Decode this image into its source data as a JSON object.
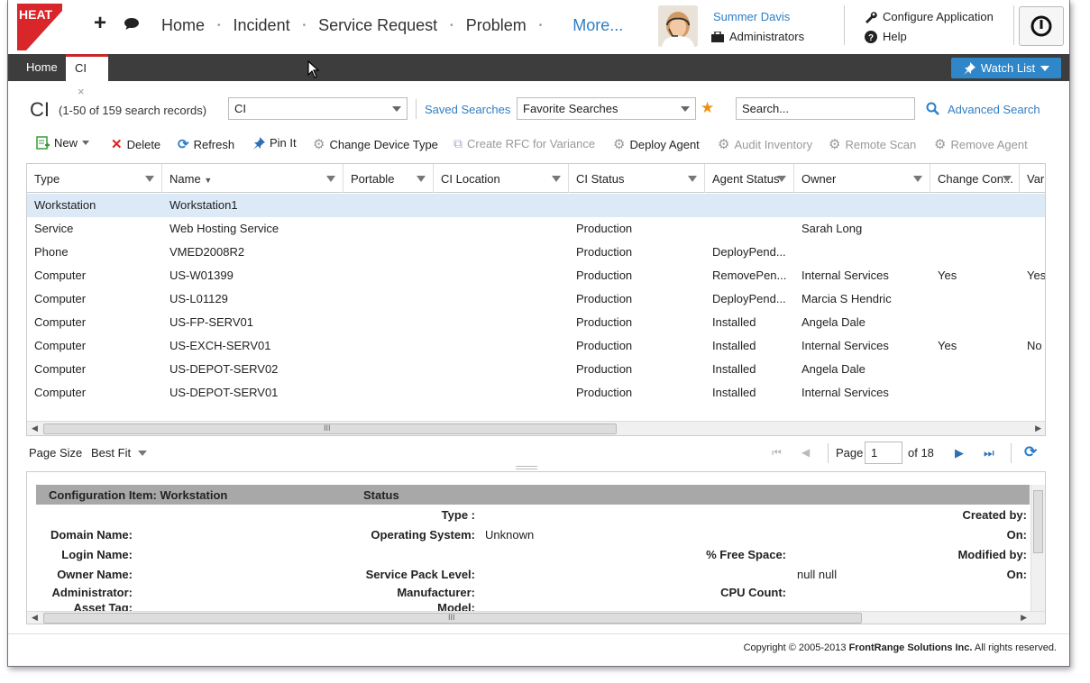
{
  "header": {
    "logo_text": "HEAT",
    "nav": [
      "Home",
      "Incident",
      "Service Request",
      "Problem"
    ],
    "more": "More...",
    "user_name": "Summer Davis",
    "user_role": "Administrators",
    "configure": "Configure Application",
    "help": "Help"
  },
  "tabs": {
    "home": "Home",
    "ci": "CI",
    "close": "×",
    "watch_list": "Watch List"
  },
  "search": {
    "title": "CI",
    "count": "(1-50 of 159 search records)",
    "object_value": "CI",
    "saved_searches": "Saved Searches",
    "favorite_value": "Favorite Searches",
    "search_placeholder": "Search...",
    "advanced": "Advanced Search"
  },
  "toolbar": {
    "new": "New",
    "delete": "Delete",
    "refresh": "Refresh",
    "pin": "Pin It",
    "change_type": "Change Device Type",
    "create_rfc": "Create RFC for Variance",
    "deploy": "Deploy Agent",
    "audit": "Audit Inventory",
    "remote_scan": "Remote Scan",
    "remove_agent": "Remove Agent"
  },
  "grid": {
    "columns": [
      "Type",
      "Name",
      "Portable",
      "CI Location",
      "CI Status",
      "Agent Status",
      "Owner",
      "Change Con...",
      "Vari"
    ],
    "rows": [
      [
        "Workstation",
        "Workstation1",
        "",
        "",
        "",
        "",
        "",
        "",
        ""
      ],
      [
        "Service",
        "Web Hosting Service",
        "",
        "",
        "Production",
        "",
        "Sarah Long",
        "",
        ""
      ],
      [
        "Phone",
        "VMED2008R2",
        "",
        "",
        "Production",
        "DeployPend...",
        "",
        "",
        ""
      ],
      [
        "Computer",
        "US-W01399",
        "",
        "",
        "Production",
        "RemovePen...",
        "Internal Services",
        "Yes",
        "Yes"
      ],
      [
        "Computer",
        "US-L01129",
        "",
        "",
        "Production",
        "DeployPend...",
        "Marcia S Hendric",
        "",
        ""
      ],
      [
        "Computer",
        "US-FP-SERV01",
        "",
        "",
        "Production",
        "Installed",
        "Angela Dale",
        "",
        ""
      ],
      [
        "Computer",
        "US-EXCH-SERV01",
        "",
        "",
        "Production",
        "Installed",
        "Internal Services",
        "Yes",
        "No"
      ],
      [
        "Computer",
        "US-DEPOT-SERV02",
        "",
        "",
        "Production",
        "Installed",
        "Angela Dale",
        "",
        ""
      ],
      [
        "Computer",
        "US-DEPOT-SERV01",
        "",
        "",
        "Production",
        "Installed",
        "Internal Services",
        "",
        ""
      ]
    ],
    "scroll_grip": "III"
  },
  "pager": {
    "page_size_label": "Page Size",
    "page_size_value": "Best Fit",
    "page_label": "Page",
    "page_value": "1",
    "of_label": "of 18"
  },
  "detail": {
    "header_title": "Configuration Item: Workstation",
    "header_status": "Status",
    "labels": {
      "type": "Type :",
      "created_by": "Created by:",
      "domain": "Domain Name:",
      "os": "Operating System:",
      "on1": "On:",
      "login": "Login Name:",
      "free_space": "% Free Space:",
      "modified_by": "Modified by:",
      "owner": "Owner Name:",
      "sp_level": "Service Pack Level:",
      "on2": "On:",
      "admin": "Administrator:",
      "manufacturer": "Manufacturer:",
      "cpu": "CPU Count:",
      "asset": "Asset Tag:",
      "model": "Model:"
    },
    "values": {
      "os": "Unknown",
      "owner_extra": "null null"
    }
  },
  "footer": {
    "prefix": "Copyright © 2005-2013 ",
    "company": "FrontRange Solutions Inc.",
    "suffix": " All rights reserved."
  },
  "colors": {
    "accent": "#2f7ec4",
    "tabbar": "#3d3d3d",
    "brand_red": "#c8262a",
    "selected_row": "#dce9f7"
  }
}
